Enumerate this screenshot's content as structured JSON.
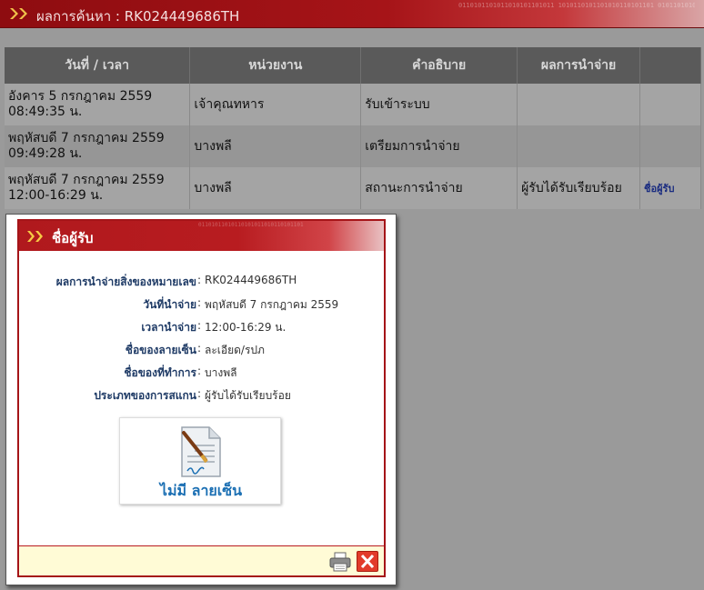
{
  "header": {
    "title": "ผลการค้นหา : RK024449686TH",
    "binary_text": "0110101101011010101101011 1010110101101010110101101 0101101010110101101010110"
  },
  "table": {
    "columns": [
      "วันที่ / เวลา",
      "หน่วยงาน",
      "คำอธิบาย",
      "ผลการนำจ่าย",
      ""
    ],
    "rows": [
      {
        "date": "อังคาร 5 กรกฎาคม 2559",
        "time": "08:49:35 น.",
        "office": "เจ้าคุณทหาร",
        "description": "รับเข้าระบบ",
        "result": "",
        "link": ""
      },
      {
        "date": "พฤหัสบดี 7 กรกฎาคม 2559",
        "time": "09:49:28 น.",
        "office": "บางพลี",
        "description": "เตรียมการนำจ่าย",
        "result": "",
        "link": ""
      },
      {
        "date": "พฤหัสบดี 7 กรกฎาคม 2559",
        "time": "12:00-16:29 น.",
        "office": "บางพลี",
        "description": "สถานะการนำจ่าย",
        "result": "ผู้รับได้รับเรียบร้อย",
        "link": "ชื่อผู้รับ"
      }
    ]
  },
  "popup": {
    "title": "ชื่อผู้รับ",
    "binary_text": "01101011010110101011010110101101",
    "fields": [
      {
        "label": "ผลการนำจ่ายสิ่งของหมายเลข",
        "value": "RK024449686TH"
      },
      {
        "label": "วันที่นำจ่าย",
        "value": "พฤหัสบดี 7 กรกฎาคม 2559"
      },
      {
        "label": "เวลานำจ่าย",
        "value": "12:00-16:29 น."
      },
      {
        "label": "ชื่อของลายเซ็น",
        "value": "ละเอียด/รปภ"
      },
      {
        "label": "ชื่อของที่ทำการ",
        "value": "บางพลี"
      },
      {
        "label": "ประเภทของการสแกน",
        "value": "ผู้รับได้รับเรียบร้อย"
      }
    ],
    "signature_text": "ไม่มี ลายเซ็น",
    "icons": {
      "print": "printer-icon",
      "close": "close-icon",
      "header": "double-chevron-icon"
    }
  },
  "colors": {
    "brand_red": "#a51418",
    "footer_bg": "#fffbd6",
    "link_blue": "#1a2c80",
    "nosig_blue": "#1b6fb3"
  }
}
